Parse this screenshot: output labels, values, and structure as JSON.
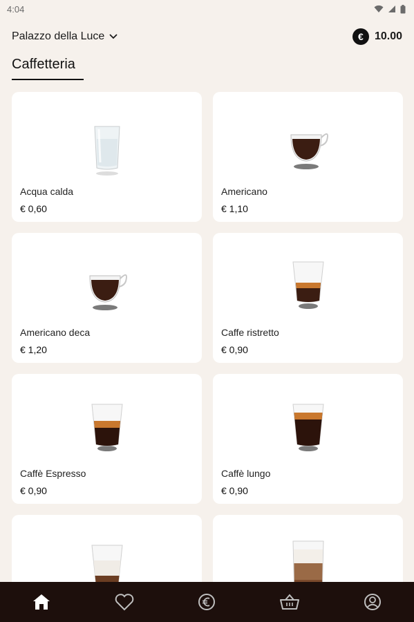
{
  "status_bar": {
    "time": "4:04"
  },
  "header": {
    "location": "Palazzo della Luce",
    "currency_symbol": "€",
    "balance": "10.00"
  },
  "category": {
    "label": "Caffetteria"
  },
  "products": [
    {
      "name": "Acqua calda",
      "price": "€ 0,60",
      "image": "glass-of-water"
    },
    {
      "name": "Americano",
      "price": "€ 1,10",
      "image": "cup-americano"
    },
    {
      "name": "Americano deca",
      "price": "€ 1,20",
      "image": "cup-americano-deca"
    },
    {
      "name": "Caffe ristretto",
      "price": "€ 0,90",
      "image": "glass-ristretto"
    },
    {
      "name": "Caffè Espresso",
      "price": "€ 0,90",
      "image": "glass-espresso"
    },
    {
      "name": "Caffè lungo",
      "price": "€ 0,90",
      "image": "glass-lungo"
    },
    {
      "name": "",
      "price": "",
      "image": "glass-macchiato"
    },
    {
      "name": "",
      "price": "",
      "image": "glass-latte"
    }
  ],
  "bottom_nav": [
    {
      "icon": "home-icon",
      "active": true
    },
    {
      "icon": "heart-icon",
      "active": false
    },
    {
      "icon": "euro-icon",
      "active": false
    },
    {
      "icon": "basket-icon",
      "active": false
    },
    {
      "icon": "profile-icon",
      "active": false
    }
  ],
  "colors": {
    "background": "#f6f1ec",
    "nav_background": "#1d0f0c",
    "coffee": "#3b1d12",
    "crema": "#c9782e"
  }
}
